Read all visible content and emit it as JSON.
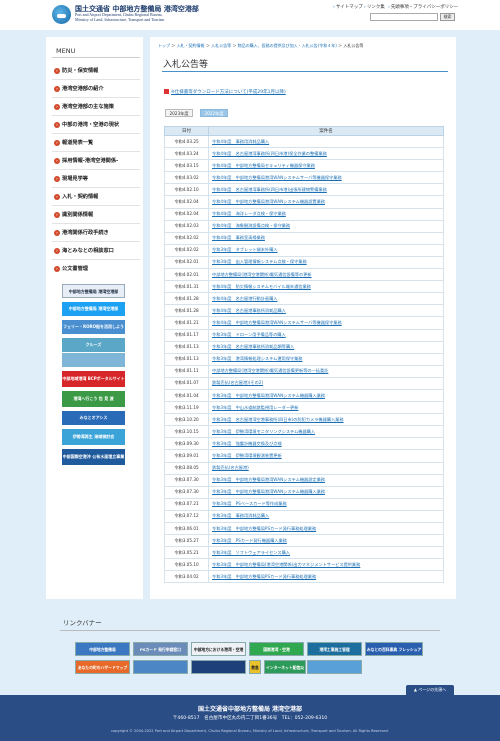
{
  "header": {
    "title": "国土交通省 中部地方整備局 港湾空港部",
    "subtitle_en_1": "Port and Airport Department, Chubu Regional Bureau,",
    "subtitle_en_2": "Ministry of Land, Infrastructure, Transport and Tourism",
    "links": [
      "サイトマップ",
      "リンク集",
      "先頭事項・プライバシーポリシー"
    ],
    "search_placeholder": "",
    "search_button": "検索"
  },
  "sidebar": {
    "menu_title": "MENU",
    "items": [
      "防災・保安情報",
      "港湾空港部の紹介",
      "港湾空港部の主な施策",
      "中部の港湾・空港の現状",
      "報道発表一覧",
      "採用情報-港湾空港関係-",
      "現場見学等",
      "入札・契約情報",
      "識別関係情報",
      "港湾関係行政手続き",
      "海とみなとの相談窓口",
      "公文書管理"
    ],
    "banners": [
      {
        "label": "中部地方整備局 港湾空港部 Facebook",
        "color": "#e8eef8",
        "text_color": "#234"
      },
      {
        "label": "中部地方整備局 港湾空港部 Twitter",
        "color": "#1da1f2",
        "text_color": "#fff"
      },
      {
        "label": "フェリー・RORO船を活用しよう",
        "color": "#4a8fd0",
        "text_color": "#fff"
      },
      {
        "label": "クルーズ",
        "color": "#5aa7c8",
        "text_color": "#fff"
      },
      {
        "label": "",
        "color": "#7fb6d8",
        "text_color": "#fff"
      },
      {
        "label": "中部地域港湾 BCPポータルサイト",
        "color": "#d7262a",
        "text_color": "#fff"
      },
      {
        "label": "港湾へ行こう 包 見 渡",
        "color": "#3c9a47",
        "text_color": "#fff"
      },
      {
        "label": "みなとオアシス",
        "color": "#2a6bb8",
        "text_color": "#fff"
      },
      {
        "label": "伊勢湾再生 海域検討会",
        "color": "#3aa3d8",
        "text_color": "#fff"
      },
      {
        "label": "中部国際空港沖 公有水面埋立事業",
        "color": "#1f5a9c",
        "text_color": "#fff"
      }
    ]
  },
  "main": {
    "breadcrumb": [
      "トップ",
      "入札・契約情報",
      "入札公告等",
      "物品の購入、役務の提供及び加入・入札公告(令和４年)",
      "入札公告等"
    ],
    "page_title": "入札公告等",
    "pdf_link": "※仕様書等ダウンロード方法について(平成29年1月以降)",
    "tabs": [
      "2023年度",
      "2022年度"
    ],
    "table_headers": [
      "日付",
      "案件名"
    ],
    "rows": [
      {
        "date": "令和4.03.25",
        "name": "令和4年度　事務用消耗品購入"
      },
      {
        "date": "令和4.03.24",
        "name": "令和4年度　名古屋港湾事務所(四日市港)保全作業の整備業務"
      },
      {
        "date": "令和4.03.15",
        "name": "令和4年度　中部地方整備局セキュリティ機器保守業務"
      },
      {
        "date": "令和4.03.02",
        "name": "令和4年度　中部地方整備局港湾WANシステムサーバ等機器保守業務"
      },
      {
        "date": "令和4.02.10",
        "name": "令和4年度　名古屋港湾事務所(四日市港)出張所建物警備業務"
      },
      {
        "date": "令和4.02.04",
        "name": "令和4年度　中部地方整備局港湾WANシステム機器設置業務"
      },
      {
        "date": "令和4.02.04",
        "name": "令和4年度　海洋レーダ点検・保守業務"
      },
      {
        "date": "令和4.02.03",
        "name": "令和4年度　海象観測設備点検・保守業務"
      },
      {
        "date": "令和4.02.02",
        "name": "令和4年度　事務室清掃業務"
      },
      {
        "date": "令和4.02.02",
        "name": "令和3年度　タブレット端末外購入"
      },
      {
        "date": "令和4.02.01",
        "name": "令和3年度　出入管理情報システム点検・保守業務"
      },
      {
        "date": "令和4.02.01",
        "name": "中部地方整備局(港湾空港関係)電気通信設備等の更新"
      },
      {
        "date": "令和4.01.31",
        "name": "令和4年度　防災情報システムモバイル端末通信業務"
      },
      {
        "date": "令和4.01.28",
        "name": "令和4年度　名古屋港行動計画購入"
      },
      {
        "date": "令和4.01.28",
        "name": "令和4年度　名古屋港事務所消耗品購入"
      },
      {
        "date": "令和4.01.21",
        "name": "令和4年度　中部地方整備局港湾WANシステムサーバ等機器保守業務"
      },
      {
        "date": "令和4.01.17",
        "name": "令和3年度　ドローン用予備品等の購入"
      },
      {
        "date": "令和4.01.13",
        "name": "令和3年度　名古屋港事務所消耗品類等購入"
      },
      {
        "date": "令和4.01.13",
        "name": "令和3年度　港湾情報処理システム運用保守業務"
      },
      {
        "date": "令和4.01.11",
        "name": "中部地方整備局(港湾空港関係)電気通信設備更新等の一括委託"
      },
      {
        "date": "令和4.01.07",
        "name": "鉄製売払(名古屋港)(その2)"
      },
      {
        "date": "令和4.01.04",
        "name": "令和3年度　中部地方整備局港湾WANシステム機器購入業務"
      },
      {
        "date": "令和3.11.19",
        "name": "令和3年度　中山水道航路監視用レーダー更新"
      },
      {
        "date": "令和3.10.20",
        "name": "令和3年度　名古屋港湾空港事務所(四日市)の防犯カメラ機器購入業務"
      },
      {
        "date": "令和3.10.15",
        "name": "令和3年度　伊勢湾環境モニタリングシステム機器購入"
      },
      {
        "date": "令和3.09.30",
        "name": "令和3年度　強震計機器交換及び点検"
      },
      {
        "date": "令和3.09.01",
        "name": "令和3年度　伊勢湾環境観測装置更新"
      },
      {
        "date": "令和3.08.05",
        "name": "鉄製売払(名古屋港)"
      },
      {
        "date": "令和3.07.30",
        "name": "令和3年度　中部地方整備局港湾WANシステム機器設定業務"
      },
      {
        "date": "令和3.07.30",
        "name": "令和3年度　中部地方整備局港湾WANシステム機器購入業務"
      },
      {
        "date": "令和3.07.21",
        "name": "令和3年度　PSベースカード等作成業務"
      },
      {
        "date": "令和3.07.12",
        "name": "令和3年度　事務用消耗品購入"
      },
      {
        "date": "令和3.06.01",
        "name": "令和3年度　中部地方整備局PSカード発行事務処理業務"
      },
      {
        "date": "令和3.05.27",
        "name": "令和3年度　PSカード発行機器購入業務"
      },
      {
        "date": "令和3.05.21",
        "name": "令和3年度　ソフトウェアライセンス購入"
      },
      {
        "date": "令和3.05.10",
        "name": "令和3年度　中部地方整備局(港湾空港関係)出力マネジメントサービス提供業務"
      },
      {
        "date": "令和3.04.02",
        "name": "令和3年度　中部地方整備局PSカード発行事務処理業務"
      }
    ]
  },
  "link_banners": {
    "title": "リンクバナー",
    "items": [
      {
        "label": "中部地方整備局",
        "color": "#3a78c2"
      },
      {
        "label": "PSカード 発行申請窓口",
        "color": "#6b8cb8"
      },
      {
        "label": "中部地方における港湾・空港の活用事例集",
        "color": "#eef2f6"
      },
      {
        "label": "国際港湾・空港",
        "color": "#2fa84f"
      },
      {
        "label": "港湾工事施工管理",
        "color": "#1c6e9e"
      },
      {
        "label": "みなとの百科事典 フレッシュアイランドなごや",
        "color": "#2a5fb0"
      },
      {
        "label": "あなたの町のハザードマップ",
        "color": "#e86a2a"
      },
      {
        "label": "",
        "color": "#4d86c4"
      },
      {
        "label": "",
        "color": "#1d3f7a"
      },
      {
        "label": "救急",
        "color": "#e9c12a"
      },
      {
        "label": "インターネット配信災害情報等",
        "color": "#2c9a58"
      },
      {
        "label": "",
        "color": "#5aa0d8"
      }
    ]
  },
  "page_top": "ページの先頭へ",
  "footer": {
    "name": "国土交通省中部地方整備局 港湾空港部",
    "address": "〒460-8517　名古屋市中区丸の内二丁目1番36号　TEL：052-209-6310",
    "copyright": "copyright © 2004-2022 Port and Airport Department, Chubu Regional Bureau, Ministry of Land, Infrastructure, Transport and Tourism. All Rights Reserved."
  }
}
